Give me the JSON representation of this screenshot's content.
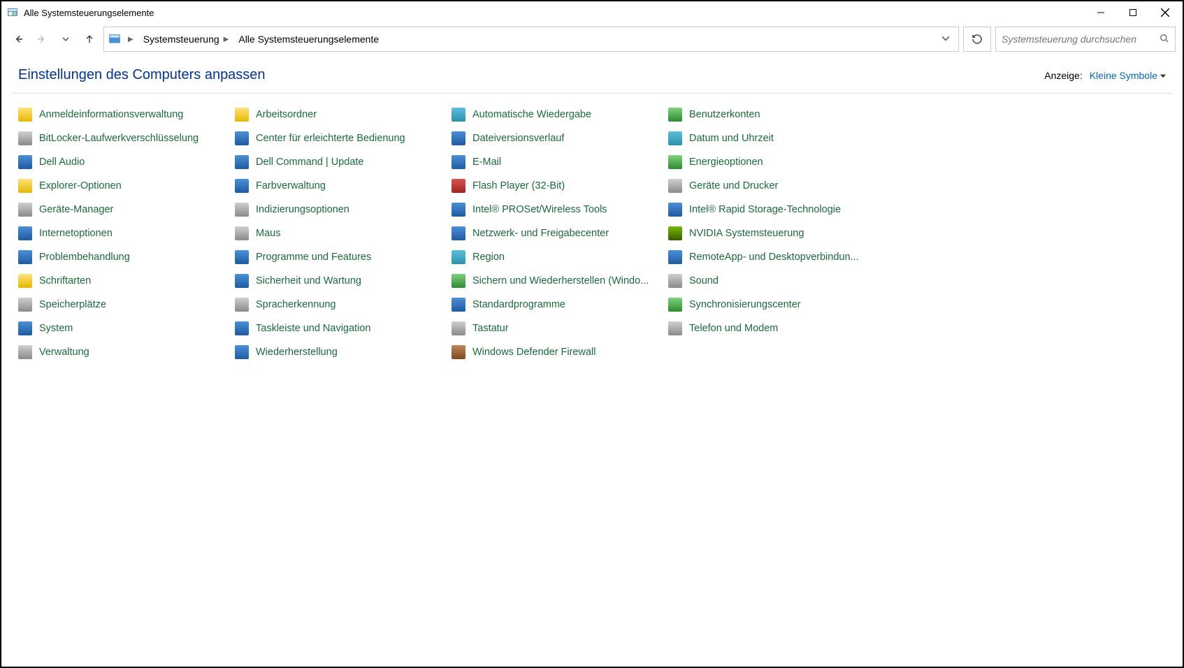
{
  "window": {
    "title": "Alle Systemsteuerungselemente"
  },
  "breadcrumbs": {
    "root": "Systemsteuerung",
    "current": "Alle Systemsteuerungselemente"
  },
  "search": {
    "placeholder": "Systemsteuerung durchsuchen"
  },
  "heading": {
    "title": "Einstellungen des Computers anpassen",
    "view_label": "Anzeige:",
    "view_value": "Kleine Symbole"
  },
  "items": [
    {
      "label": "Anmeldeinformationsverwaltung",
      "iconClass": "ic-yellow",
      "slug": "credential-manager"
    },
    {
      "label": "Arbeitsordner",
      "iconClass": "ic-yellow",
      "slug": "work-folders"
    },
    {
      "label": "Automatische Wiedergabe",
      "iconClass": "ic-teal",
      "slug": "autoplay"
    },
    {
      "label": "Benutzerkonten",
      "iconClass": "ic-green",
      "slug": "user-accounts"
    },
    {
      "label": "BitLocker-Laufwerkverschlüsselung",
      "iconClass": "ic-gray",
      "slug": "bitlocker"
    },
    {
      "label": "Center für erleichterte Bedienung",
      "iconClass": "ic-blue",
      "slug": "ease-of-access"
    },
    {
      "label": "Dateiversionsverlauf",
      "iconClass": "ic-blue",
      "slug": "file-history"
    },
    {
      "label": "Datum und Uhrzeit",
      "iconClass": "ic-teal",
      "slug": "date-time"
    },
    {
      "label": "Dell Audio",
      "iconClass": "ic-blue",
      "slug": "dell-audio"
    },
    {
      "label": "Dell Command | Update",
      "iconClass": "ic-blue",
      "slug": "dell-command-update"
    },
    {
      "label": "E-Mail",
      "iconClass": "ic-blue",
      "slug": "mail"
    },
    {
      "label": "Energieoptionen",
      "iconClass": "ic-green",
      "slug": "power-options"
    },
    {
      "label": "Explorer-Optionen",
      "iconClass": "ic-yellow",
      "slug": "explorer-options"
    },
    {
      "label": "Farbverwaltung",
      "iconClass": "ic-blue",
      "slug": "color-management"
    },
    {
      "label": "Flash Player (32-Bit)",
      "iconClass": "ic-red",
      "slug": "flash-player"
    },
    {
      "label": "Geräte und Drucker",
      "iconClass": "ic-gray",
      "slug": "devices-printers"
    },
    {
      "label": "Geräte-Manager",
      "iconClass": "ic-gray",
      "slug": "device-manager"
    },
    {
      "label": "Indizierungsoptionen",
      "iconClass": "ic-gray",
      "slug": "indexing-options"
    },
    {
      "label": "Intel® PROSet/Wireless Tools",
      "iconClass": "ic-blue",
      "slug": "intel-proset"
    },
    {
      "label": "Intel® Rapid Storage-Technologie",
      "iconClass": "ic-blue",
      "slug": "intel-rst"
    },
    {
      "label": "Internetoptionen",
      "iconClass": "ic-blue",
      "slug": "internet-options"
    },
    {
      "label": "Maus",
      "iconClass": "ic-gray",
      "slug": "mouse"
    },
    {
      "label": "Netzwerk- und Freigabecenter",
      "iconClass": "ic-blue",
      "slug": "network-sharing"
    },
    {
      "label": "NVIDIA Systemsteuerung",
      "iconClass": "ic-nvidia",
      "slug": "nvidia-control-panel"
    },
    {
      "label": "Problembehandlung",
      "iconClass": "ic-blue",
      "slug": "troubleshooting"
    },
    {
      "label": "Programme und Features",
      "iconClass": "ic-blue",
      "slug": "programs-features"
    },
    {
      "label": "Region",
      "iconClass": "ic-teal",
      "slug": "region"
    },
    {
      "label": "RemoteApp- und Desktopverbindun...",
      "iconClass": "ic-blue",
      "slug": "remoteapp"
    },
    {
      "label": "Schriftarten",
      "iconClass": "ic-yellow",
      "slug": "fonts"
    },
    {
      "label": "Sicherheit und Wartung",
      "iconClass": "ic-blue",
      "slug": "security-maintenance"
    },
    {
      "label": "Sichern und Wiederherstellen (Windo...",
      "iconClass": "ic-green",
      "slug": "backup-restore"
    },
    {
      "label": "Sound",
      "iconClass": "ic-gray",
      "slug": "sound"
    },
    {
      "label": "Speicherplätze",
      "iconClass": "ic-gray",
      "slug": "storage-spaces"
    },
    {
      "label": "Spracherkennung",
      "iconClass": "ic-gray",
      "slug": "speech-recognition"
    },
    {
      "label": "Standardprogramme",
      "iconClass": "ic-blue",
      "slug": "default-programs"
    },
    {
      "label": "Synchronisierungscenter",
      "iconClass": "ic-green",
      "slug": "sync-center"
    },
    {
      "label": "System",
      "iconClass": "ic-blue",
      "slug": "system"
    },
    {
      "label": "Taskleiste und Navigation",
      "iconClass": "ic-blue",
      "slug": "taskbar-navigation"
    },
    {
      "label": "Tastatur",
      "iconClass": "ic-gray",
      "slug": "keyboard"
    },
    {
      "label": "Telefon und Modem",
      "iconClass": "ic-gray",
      "slug": "phone-modem"
    },
    {
      "label": "Verwaltung",
      "iconClass": "ic-gray",
      "slug": "admin-tools"
    },
    {
      "label": "Wiederherstellung",
      "iconClass": "ic-blue",
      "slug": "recovery"
    },
    {
      "label": "Windows Defender Firewall",
      "iconClass": "ic-brown",
      "slug": "defender-firewall"
    }
  ]
}
